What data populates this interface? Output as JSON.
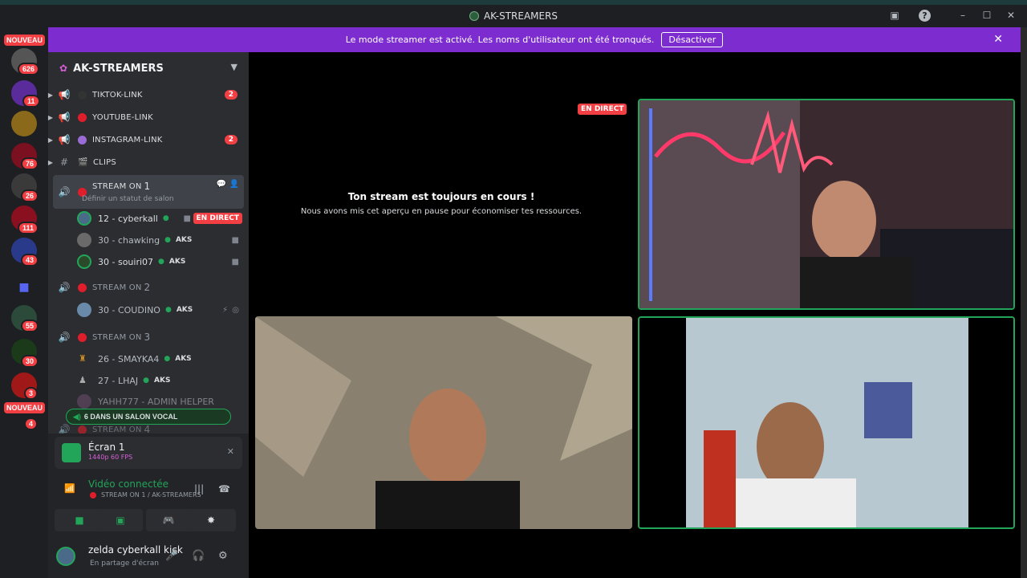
{
  "window": {
    "title": "AK-STREAMERS"
  },
  "servers": {
    "top_label": "NOUVEAU",
    "bottom_label": "NOUVEAU",
    "badges": [
      "626",
      "11",
      "76",
      "26",
      "111",
      "43",
      "55",
      "30",
      "3",
      "4"
    ]
  },
  "banner": {
    "text": "Le mode streamer est activé. Les noms d'utilisateur ont été tronqués.",
    "button": "Désactiver"
  },
  "guild": {
    "name": "AK-STREAMERS"
  },
  "channels": [
    {
      "name": "tiktok-link",
      "count": "2"
    },
    {
      "name": "youtube-link"
    },
    {
      "name": "instagram-link",
      "count": "2"
    },
    {
      "name": "clips"
    }
  ],
  "stream1": {
    "name": "STREAM ON",
    "num": "1",
    "status": "Définir un statut de salon"
  },
  "stream1_users": [
    {
      "name": "12 - cyberkall",
      "badge": "EN DIRECT"
    },
    {
      "name": "30 - chawking",
      "tag": "AKS"
    },
    {
      "name": "30 - souiri07",
      "tag": "AKS"
    }
  ],
  "stream2": {
    "name": "STREAM ON",
    "num": "2"
  },
  "stream2_users": [
    {
      "name": "30 - COUDINO",
      "tag": "AKS"
    }
  ],
  "stream3": {
    "name": "STREAM ON",
    "num": "3"
  },
  "stream3_users": [
    {
      "name": "26 - SMAYKA4",
      "tag": "AKS"
    },
    {
      "name": "27 - LHAJ",
      "tag": "AKS"
    },
    {
      "name": "YAHH777 - ADMIN HELPER"
    }
  ],
  "stream4": {
    "name": "STREAM ON",
    "num": "4"
  },
  "vocal_pill": "6 DANS UN SALON VOCAL",
  "panel": {
    "screen_title": "Écran 1",
    "screen_sub": "1440p 60 FPS",
    "video_status": "Vidéo connectée",
    "video_sub": "STREAM ON 1 / AK-STREAMERS",
    "user_name": "zelda cyberkall kick",
    "user_status": "En partage d'écran"
  },
  "stage": {
    "live_badge": "EN DIRECT",
    "paused_title": "Ton stream est toujours en cours !",
    "paused_sub": "Nous avons mis cet aperçu en pause pour économiser tes ressources."
  },
  "colors": {
    "accent": "#7d2ccf",
    "live": "#f23f43",
    "speaking": "#23a559"
  }
}
